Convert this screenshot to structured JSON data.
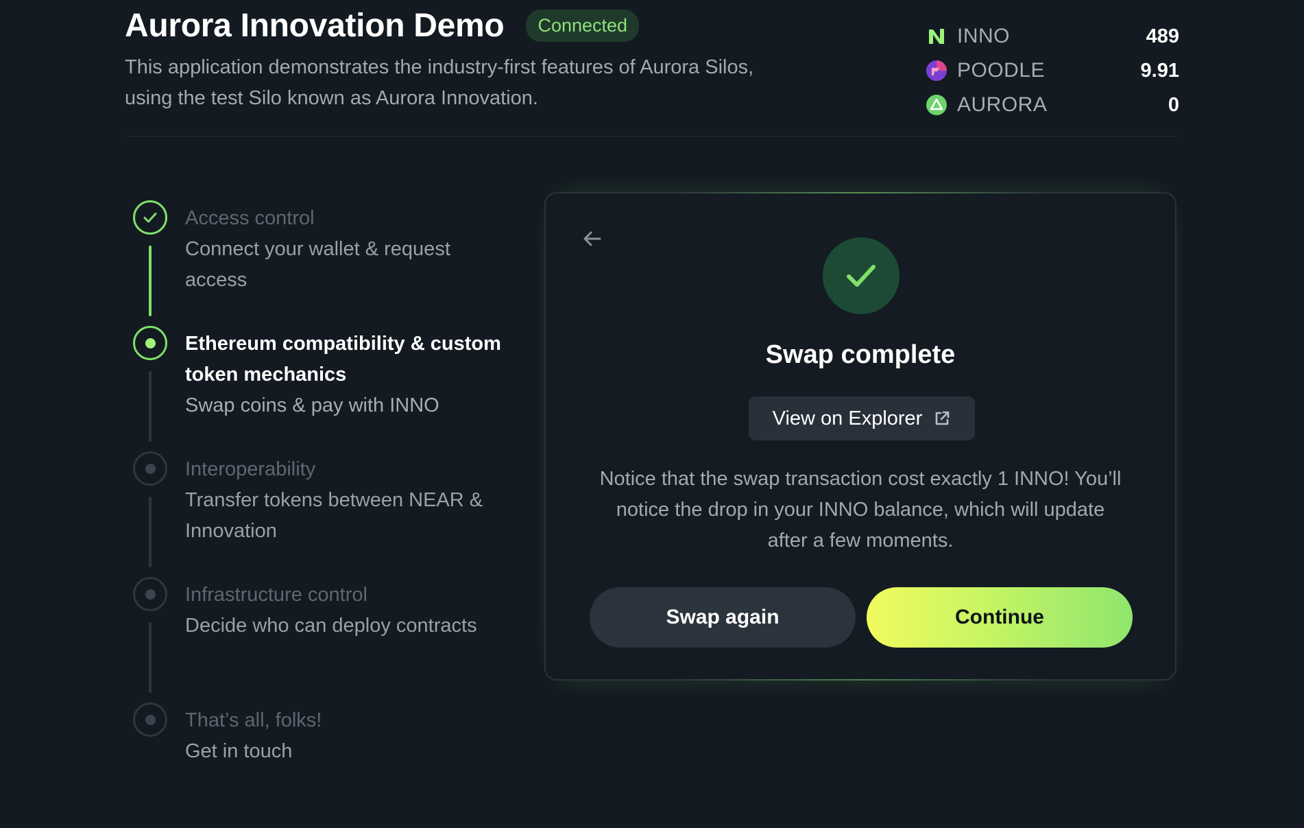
{
  "header": {
    "title": "Aurora Innovation Demo",
    "status": "Connected",
    "description": "This application demonstrates the industry-first features of Aurora Silos, using the test Silo known as Aurora Innovation."
  },
  "balances": [
    {
      "name": "INNO",
      "amount": "489",
      "icon": "inno-logo-icon"
    },
    {
      "name": "POODLE",
      "amount": "9.91",
      "icon": "poodle-logo-icon"
    },
    {
      "name": "AURORA",
      "amount": "0",
      "icon": "aurora-logo-icon"
    }
  ],
  "steps": [
    {
      "title": "Access control",
      "subtitle": "Connect your wallet & request access",
      "state": "done"
    },
    {
      "title": "Ethereum compatibility & custom token mechanics",
      "subtitle": "Swap coins & pay with INNO",
      "state": "active"
    },
    {
      "title": "Interoperability",
      "subtitle": "Transfer tokens between NEAR & Innovation",
      "state": "pending"
    },
    {
      "title": "Infrastructure control",
      "subtitle": "Decide who can deploy contracts",
      "state": "pending"
    },
    {
      "title": "That’s all, folks!",
      "subtitle": "Get in touch",
      "state": "pending"
    }
  ],
  "card": {
    "back_icon": "arrow-left-icon",
    "success_icon": "checkmark-icon",
    "title": "Swap complete",
    "explorer_label": "View on Explorer",
    "explorer_icon": "external-link-icon",
    "notice": "Notice that the swap transaction cost exactly 1 INNO! You’ll notice the drop in your INNO balance, which will update after a few moments.",
    "secondary_button": "Swap again",
    "primary_button": "Continue"
  },
  "colors": {
    "background": "#131a21",
    "accent_green": "#7fe06a",
    "status_badge_bg": "#1f3a2b",
    "primary_gradient_start": "#f1fb5e",
    "primary_gradient_end": "#8fe56e"
  }
}
